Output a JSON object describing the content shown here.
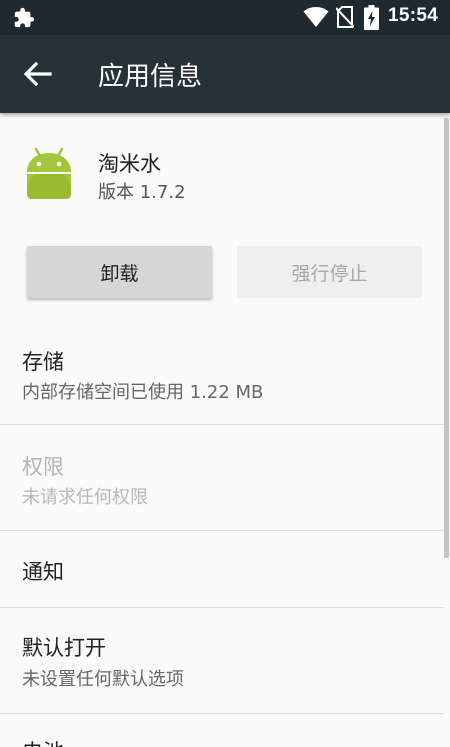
{
  "status_bar": {
    "time": "15:54",
    "icons": [
      "puzzle-icon",
      "wifi-icon",
      "no-sim-icon",
      "battery-charging-icon"
    ]
  },
  "app_bar": {
    "title": "应用信息",
    "back_icon": "arrow-back-icon"
  },
  "app": {
    "name": "淘米水",
    "version": "版本 1.7.2",
    "icon": "android-icon"
  },
  "buttons": {
    "uninstall": "卸载",
    "force_stop": "强行停止"
  },
  "prefs": [
    {
      "title": "存储",
      "summary": "内部存储空间已使用 1.22 MB",
      "enabled": true
    },
    {
      "title": "权限",
      "summary": "未请求任何权限",
      "enabled": false
    },
    {
      "title": "通知",
      "summary": "",
      "enabled": true
    },
    {
      "title": "默认打开",
      "summary": "未设置任何默认选项",
      "enabled": true
    },
    {
      "title": "电池",
      "summary": "",
      "enabled": true
    }
  ],
  "colors": {
    "status_bar_bg": "#1f2a30",
    "app_bar_bg": "#263238",
    "android_green": "#a4c639",
    "page_bg": "#fafafa"
  }
}
